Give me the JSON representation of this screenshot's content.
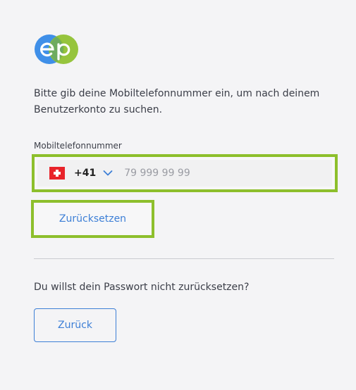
{
  "logo": {
    "icon": "ep-logo-icon",
    "colors": {
      "blue": "#3f8fe8",
      "green": "#8dbf2c"
    }
  },
  "intro_text": "Bitte gib deine Mobiltelefonnummer ein, um nach deinem Benutzerkonto zu suchen.",
  "phone": {
    "label": "Mobiltelefonnummer",
    "country_flag_icon": "swiss-flag-icon",
    "country_code": "+41",
    "dropdown_icon": "chevron-down-icon",
    "value": "",
    "placeholder": "79 999 99 99"
  },
  "reset_button_label": "Zurücksetzen",
  "question_text": "Du willst dein Passwort nicht zurücksetzen?",
  "back_button_label": "Zurück",
  "colors": {
    "accent_blue": "#3d7fd6",
    "focus_green": "#8dbf2c",
    "background": "#f4f4f6"
  }
}
